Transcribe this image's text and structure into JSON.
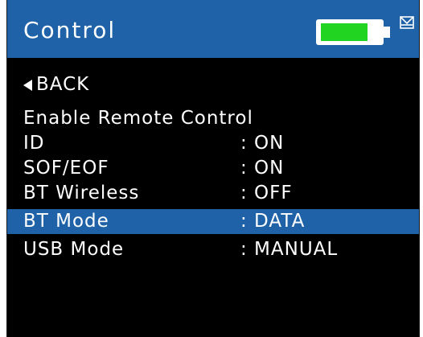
{
  "header": {
    "title": "Control",
    "battery_icon": "battery-full-icon",
    "battery_level": 0.8,
    "battery_color": "#22d422",
    "mail_icon": "envelope-icon"
  },
  "colors": {
    "accent": "#1f62a8",
    "background": "#000000",
    "text": "#ffffff"
  },
  "menu": {
    "back": {
      "icon": "back-arrow-icon",
      "label": "BACK"
    },
    "enable_remote_control": "Enable Remote Control",
    "items": [
      {
        "label": "ID",
        "value": ": ON"
      },
      {
        "label": "SOF/EOF",
        "value": ": ON"
      },
      {
        "label": "BT Wireless",
        "value": ": OFF"
      },
      {
        "label": "BT Mode",
        "value": ": DATA"
      },
      {
        "label": "USB Mode",
        "value": ": MANUAL"
      }
    ],
    "selected_item": "BT Mode"
  }
}
